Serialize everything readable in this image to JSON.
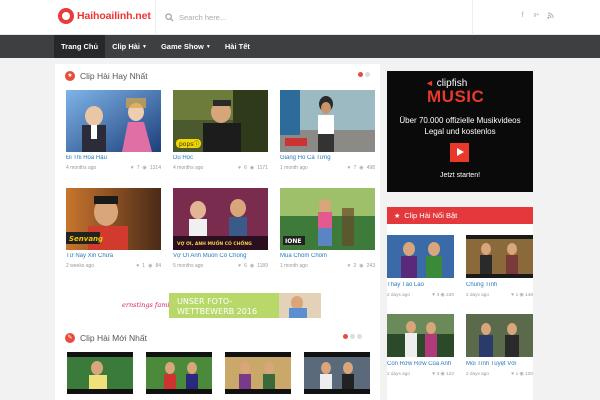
{
  "header": {
    "logo_text": "Haihoailinh.net",
    "search_placeholder": "Search here...",
    "social": [
      "f",
      "g+",
      "rss"
    ]
  },
  "nav": {
    "items": [
      {
        "label": "Trang Chủ",
        "active": true,
        "dropdown": false
      },
      {
        "label": "Clip Hài",
        "active": false,
        "dropdown": true
      },
      {
        "label": "Game Show",
        "active": false,
        "dropdown": true
      },
      {
        "label": "Hài Tết",
        "active": false,
        "dropdown": false
      }
    ]
  },
  "section1": {
    "title": "Clip Hài Hay Nhất",
    "cards": [
      {
        "title": "Đi Thi Hoa Hậu",
        "time": "4 months ago",
        "likes": "7",
        "views": "1314"
      },
      {
        "title": "Du Học",
        "time": "4 months ago",
        "likes": "6",
        "views": "1171",
        "logo": "popsⓘ"
      },
      {
        "title": "Giang Hồ Cà Tưng",
        "time": "1 month ago",
        "likes": "7",
        "views": "498"
      },
      {
        "title": "Từ Nay Xin Chừa",
        "time": "2 weeks ago",
        "likes": "1",
        "views": "84",
        "logo": "Senvang"
      },
      {
        "title": "Vợ Ơi Anh Muốn Có Chồng",
        "time": "5 months ago",
        "likes": "6",
        "views": "1189",
        "caption": "VỢ ƠI, ANH MUỐN CÓ CHỒNG"
      },
      {
        "title": "Mua Chôm Chôm",
        "time": "1 month ago",
        "likes": "2",
        "views": "243",
        "logo": "IONE"
      }
    ]
  },
  "banner": {
    "brand": "ernstings family",
    "line1": "UNSER FOTO-",
    "line2": "WETTBEWERB 2016"
  },
  "section2": {
    "title": "Clip Hài Mới Nhất"
  },
  "ad": {
    "brand": "clipfish",
    "headline": "MUSIC",
    "line1": "Über 70.000 offizielle Musikvideos",
    "line2": "Legal und kostenlos",
    "cta": "Jetzt starten!"
  },
  "sidebar": {
    "title": "Clip Hài Nổi Bật",
    "cards": [
      {
        "title": "Thầy Tào Lao",
        "time": "2 days ago",
        "likes": "3",
        "views": "220"
      },
      {
        "title": "Chung Tình",
        "time": "2 days ago",
        "likes": "1",
        "views": "148"
      },
      {
        "title": "Con Rơw Rơw Của Anh",
        "time": "2 days ago",
        "likes": "3",
        "views": "122"
      },
      {
        "title": "Mối Tình Tuyệt Vời",
        "time": "2 days ago",
        "likes": "1",
        "views": "120"
      }
    ]
  },
  "colors": {
    "accent": "#e4393c",
    "nav_bg": "#3d3f41",
    "link": "#2a7ab8"
  }
}
